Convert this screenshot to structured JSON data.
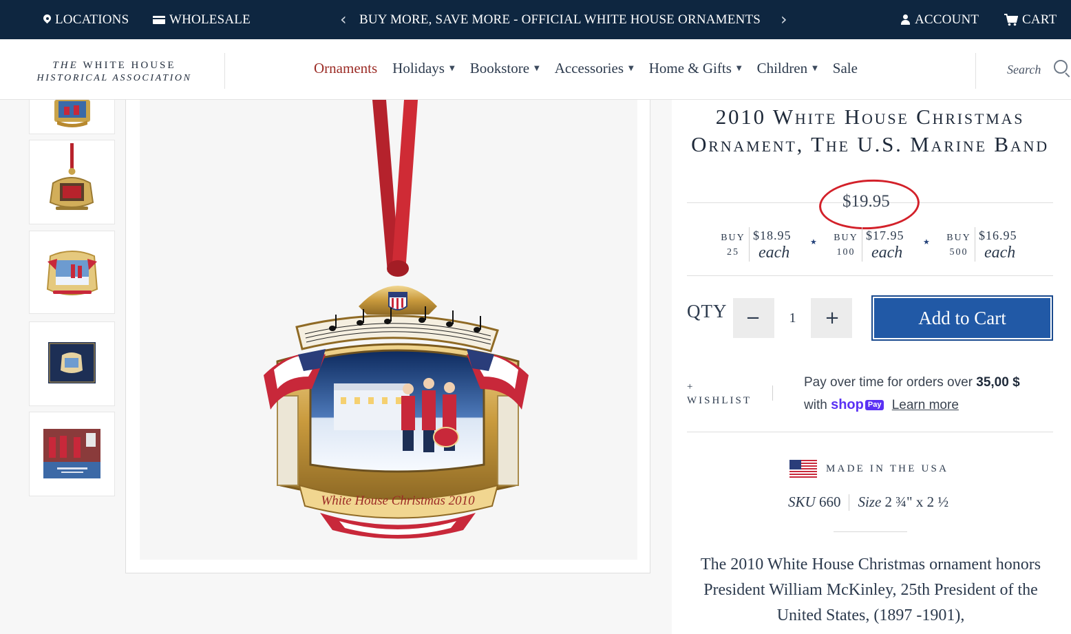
{
  "topbar": {
    "locations": "LOCATIONS",
    "wholesale": "WHOLESALE",
    "promo": "BUY MORE, SAVE MORE - OFFICIAL WHITE HOUSE ORNAMENTS",
    "account": "ACCOUNT",
    "cart": "CART",
    "bg_color": "#0e2640"
  },
  "logo": {
    "line1_prefix": "THE",
    "line1_main": "WHITE HOUSE",
    "line2": "HISTORICAL ASSOCIATION"
  },
  "nav": {
    "items": [
      {
        "label": "Ornaments",
        "active": true
      },
      {
        "label": "Holidays",
        "caret": true
      },
      {
        "label": "Bookstore",
        "caret": true
      },
      {
        "label": "Accessories",
        "caret": true
      },
      {
        "label": "Home & Gifts",
        "caret": true
      },
      {
        "label": "Children",
        "caret": true
      },
      {
        "label": "Sale"
      }
    ],
    "active_color": "#9b2b25"
  },
  "search": {
    "placeholder": "Search"
  },
  "gallery": {
    "thumbnail_count": 5,
    "ornament_text": "White House Christmas 2010"
  },
  "product": {
    "title": "2010 White House Christmas Ornament, The U.S. Marine Band",
    "price": "$19.95",
    "price_annotation_color": "#d3212a",
    "tiers": [
      {
        "buy": "BUY",
        "qty": "25",
        "price": "$18.95",
        "each": "each"
      },
      {
        "buy": "BUY",
        "qty": "100",
        "price": "$17.95",
        "each": "each"
      },
      {
        "buy": "BUY",
        "qty": "500",
        "price": "$16.95",
        "each": "each"
      }
    ],
    "qty_label": "QTY",
    "qty_value": "1",
    "add_to_cart": "Add to Cart",
    "button_color": "#2159a6",
    "wishlist_plus": "+",
    "wishlist": "WISHLIST",
    "shoppay": {
      "line1_prefix": "Pay over time for orders over",
      "threshold": "35,00 $",
      "with": "with",
      "shop": "shop",
      "pay": "Pay",
      "learn_more": "Learn more"
    },
    "made_in": "MADE IN THE USA",
    "sku_label": "SKU",
    "sku": "660",
    "size_label": "Size",
    "size": "2 ¾\" x 2 ½",
    "description": "The 2010 White House Christmas ornament honors President William McKinley, 25th President of the United States, (1897 -1901),"
  }
}
